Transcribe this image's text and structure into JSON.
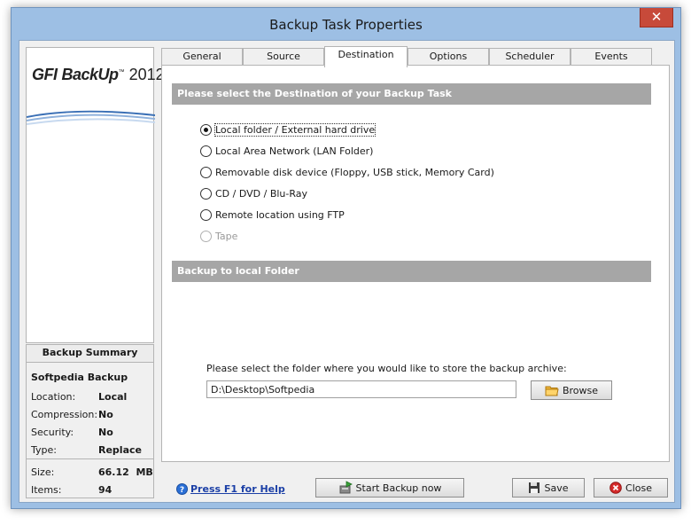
{
  "window": {
    "title": "Backup Task Properties",
    "close_glyph": "✕"
  },
  "logo": {
    "brand": "GFI",
    "product": "BackUp",
    "tm": "™",
    "year": "2012"
  },
  "summary": {
    "heading": "Backup Summary",
    "name": "Softpedia Backup",
    "rows": [
      {
        "key": "Location:",
        "value": "Local"
      },
      {
        "key": "Compression:",
        "value": "No"
      },
      {
        "key": "Security:",
        "value": "No"
      },
      {
        "key": "Type:",
        "value": "Replace"
      },
      {
        "key": "Size:",
        "value": "66.12  MB"
      },
      {
        "key": "Items:",
        "value": "94"
      }
    ]
  },
  "tabs": [
    "General",
    "Source",
    "Destination",
    "Options",
    "Scheduler",
    "Events"
  ],
  "active_tab": "Destination",
  "destination": {
    "heading": "Please select the Destination of your Backup Task",
    "options": [
      {
        "label": "Local folder / External hard drive",
        "selected": true,
        "disabled": false
      },
      {
        "label": "Local Area Network (LAN Folder)",
        "selected": false,
        "disabled": false
      },
      {
        "label": "Removable disk device (Floppy, USB stick, Memory Card)",
        "selected": false,
        "disabled": false
      },
      {
        "label": "CD / DVD / Blu-Ray",
        "selected": false,
        "disabled": false
      },
      {
        "label": "Remote location using FTP",
        "selected": false,
        "disabled": false
      },
      {
        "label": "Tape",
        "selected": false,
        "disabled": true
      }
    ]
  },
  "local_folder": {
    "heading": "Backup to local Folder",
    "prompt": "Please select the folder where you would like to store the backup archive:",
    "path": "D:\\Desktop\\Softpedia",
    "browse_label": "Browse"
  },
  "footer": {
    "help_label": "Press F1 for Help",
    "start_label": "Start Backup now",
    "save_label": "Save",
    "close_label": "Close"
  },
  "colors": {
    "section_header": "#a6a6a6",
    "window_frame": "#9dbfe4",
    "link": "#1b3fa6",
    "close_button": "#c74a3a"
  }
}
